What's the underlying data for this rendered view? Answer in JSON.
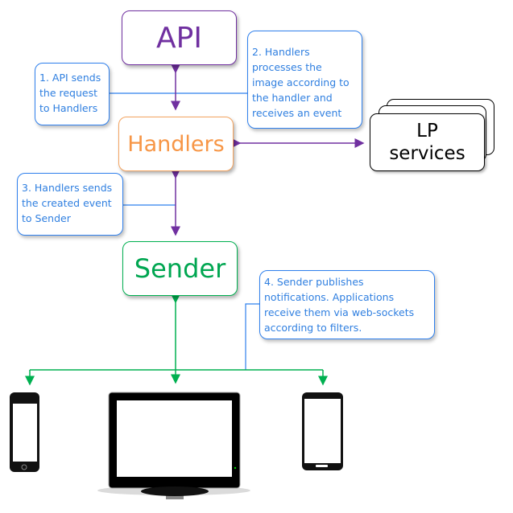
{
  "nodes": {
    "api": "API",
    "handlers": "Handlers",
    "sender": "Sender",
    "lp_services": {
      "line1": "LP",
      "line2": "services"
    }
  },
  "notes": [
    {
      "lines": [
        "1. API sends",
        "the request",
        "to Handlers"
      ]
    },
    {
      "lines": [
        "2. Handlers",
        "processes the",
        "image according to",
        "the handler and",
        "receives an event"
      ]
    },
    {
      "lines": [
        "3. Handlers sends",
        "the created event",
        "to Sender"
      ]
    },
    {
      "lines": [
        "4. Sender publishes",
        "notifications. Applications",
        "receive them via web-sockets",
        "according to filters."
      ]
    }
  ],
  "devices": [
    "iphone-icon",
    "desktop-monitor-icon",
    "android-phone-icon"
  ],
  "colors": {
    "api": "#7030a0",
    "handlers": "#f79646",
    "sender": "#00b050",
    "note": "#2f80ed",
    "arrow_purple": "#7030a0",
    "arrow_green": "#00b050"
  }
}
